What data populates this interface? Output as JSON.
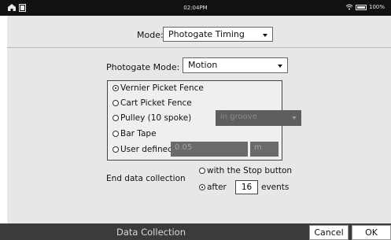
{
  "status": {
    "time": "02:04PM",
    "battery": "100%"
  },
  "mode": {
    "label": "Mode:",
    "value": "Photogate Timing"
  },
  "photogate_mode": {
    "label": "Photogate Mode:",
    "value": "Motion"
  },
  "options": [
    {
      "label": "Vernier Picket Fence",
      "selected": true
    },
    {
      "label": "Cart Picket Fence",
      "selected": false
    },
    {
      "label": "Pulley (10 spoke)",
      "selected": false
    },
    {
      "label": "Bar Tape",
      "selected": false
    },
    {
      "label": "User defined",
      "selected": false
    }
  ],
  "pulley_select": {
    "value": "in groove"
  },
  "user_defined": {
    "value": "0.05",
    "unit": "m"
  },
  "end": {
    "label": "End data collection",
    "stop_label": "with the Stop button",
    "after_label": "after",
    "events_value": "16",
    "events_label": "events",
    "selected": "after"
  },
  "footer": {
    "title": "Data Collection",
    "cancel": "Cancel",
    "ok": "OK"
  }
}
